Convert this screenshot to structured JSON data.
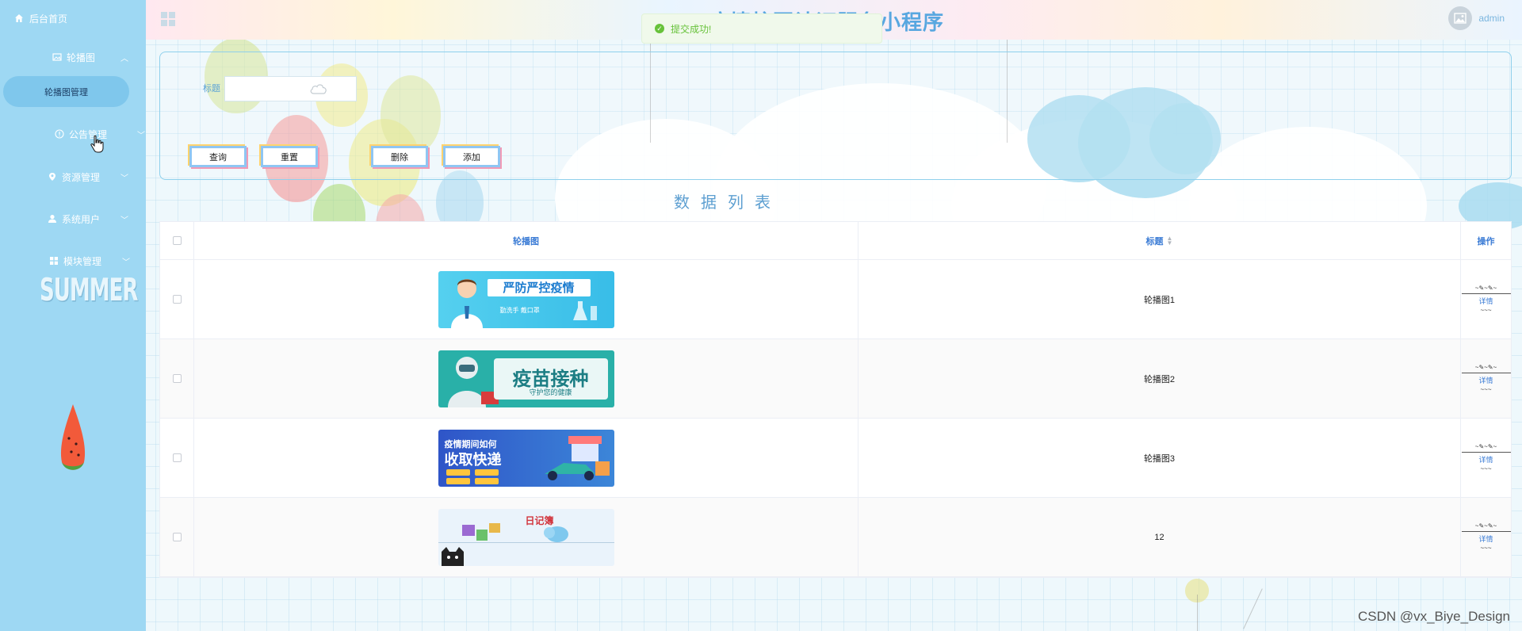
{
  "sidebar": {
    "home_label": "后台首页",
    "groups": [
      {
        "label": "轮播图",
        "expanded": true
      },
      {
        "label": "公告管理",
        "expanded": false
      },
      {
        "label": "资源管理",
        "expanded": false
      },
      {
        "label": "系统用户",
        "expanded": false
      },
      {
        "label": "模块管理",
        "expanded": false
      }
    ],
    "active_sub_item": "轮播图管理",
    "decor_text": "SUMMER"
  },
  "header": {
    "title": "疫情校园认证服务小程序",
    "user_name": "admin"
  },
  "toast": {
    "message": "提交成功!",
    "type": "success"
  },
  "search": {
    "label": "标题",
    "value": "",
    "buttons": {
      "query": "查询",
      "reset": "重置",
      "delete": "删除",
      "add": "添加"
    }
  },
  "list": {
    "title": "数据列表",
    "columns": {
      "image": "轮播图",
      "title": "标题",
      "actions": "操作"
    },
    "rows": [
      {
        "title": "轮播图1",
        "banner_text": "严防严控疫情",
        "banner_sub": "勤洗手 戴口罩",
        "action": "详情"
      },
      {
        "title": "轮播图2",
        "banner_text": "疫苗接种",
        "banner_sub": "守护您的健康",
        "action": "详情"
      },
      {
        "title": "轮播图3",
        "banner_text": "收取快递",
        "banner_sub": "疫情期间如何",
        "action": "详情"
      },
      {
        "title": "12",
        "banner_text": "日记簿",
        "banner_sub": "",
        "action": "详情"
      }
    ]
  },
  "footer": {
    "credit": "CSDN @vx_Biye_Design"
  },
  "colors": {
    "sidebar_bg": "#9ed8f3",
    "accent": "#3a7bd5",
    "success": "#67c23a",
    "title": "#58a7e0"
  }
}
